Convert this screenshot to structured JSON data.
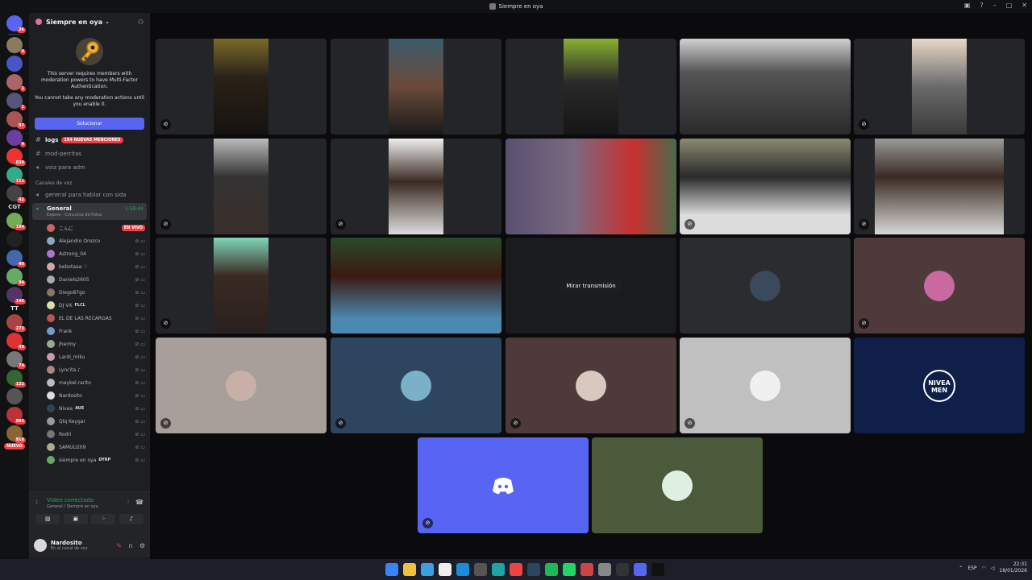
{
  "window": {
    "title": "Siempre en oya"
  },
  "guilds": {
    "badges": [
      "26",
      "4",
      "1",
      "1",
      "97",
      "4",
      "839",
      "111",
      "42",
      "184",
      "40",
      "94",
      "146",
      "273",
      "49",
      "74",
      "122",
      "593",
      "918"
    ],
    "text_item": "CGT",
    "text_item2": "TT",
    "new_label": "NUEVO"
  },
  "server": {
    "name": "Siempre en oya",
    "mfa_text1": "This server requires members with moderation powers to have Multi-Factor Authentication.",
    "mfa_text2": "You cannot take any moderation actions until you enable it.",
    "fix_button": "Solucionar"
  },
  "channels": [
    {
      "name": "logs",
      "mention": "194 NUEVAS MENCIONES",
      "type": "text"
    },
    {
      "name": "mod-perritas",
      "type": "text"
    },
    {
      "name": "voiz para adm",
      "type": "voice"
    }
  ],
  "voice_category": "Canales de voz",
  "voice_channels": [
    {
      "name": "general para hablar con sida"
    }
  ],
  "active_voice": {
    "name": "General",
    "timer": "1:58:44",
    "activity": "Expore - Concurso de Fotos"
  },
  "members": [
    {
      "name": "こんに",
      "live": "EN VIVO"
    },
    {
      "name": "Alejandro Orozco"
    },
    {
      "name": "Astrong_04"
    },
    {
      "name": "bebotaaa ♡"
    },
    {
      "name": "Daniels2605"
    },
    {
      "name": "Diego87go"
    },
    {
      "name": "DJ VX",
      "tag": "FLCL"
    },
    {
      "name": "EL DE LAS RECARGAS"
    },
    {
      "name": "Frank"
    },
    {
      "name": "Jhermy"
    },
    {
      "name": "Lardi_miku"
    },
    {
      "name": "Lyncita ♪"
    },
    {
      "name": "maykel.rarito"
    },
    {
      "name": "Nardosito"
    },
    {
      "name": "Nivea",
      "tag": "AUE"
    },
    {
      "name": "Qlq Keygar"
    },
    {
      "name": "Rodri"
    },
    {
      "name": "SAMUU209"
    },
    {
      "name": "siempre en oya",
      "tag": "DYRP"
    }
  ],
  "voice_panel": {
    "title": "Video conectado",
    "subtitle": "General / Siempre en oya"
  },
  "user": {
    "name": "Nardosito",
    "status": "En el canal de voz"
  },
  "stage": {
    "watch_stream": "Mirar transmisión",
    "nivea_logo": "NIVEA MEN"
  },
  "colors": {
    "accent": "#5865f2",
    "speaking": "#23a55a",
    "danger": "#f23f43"
  },
  "taskbar": {
    "lang": "ESP",
    "time": "22:31",
    "date": "18/01/2026"
  }
}
